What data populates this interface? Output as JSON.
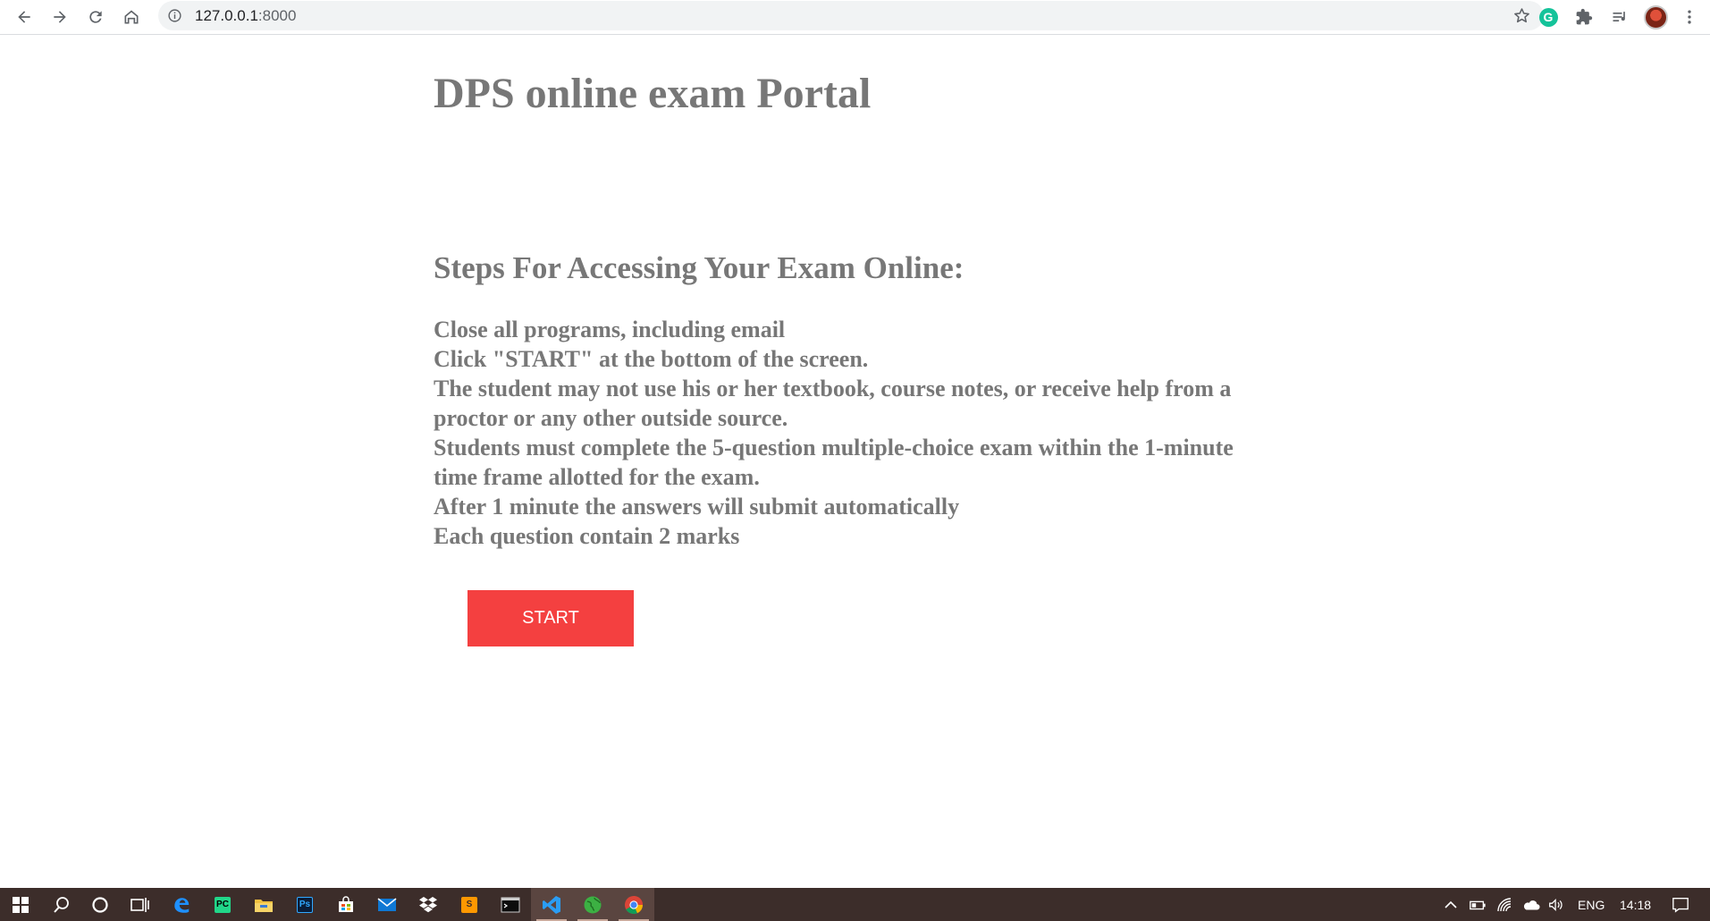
{
  "browser": {
    "url_host": "127.0.0.1",
    "url_port": ":8000",
    "grammarly_letter": "G",
    "icons": [
      "back-arrow-icon",
      "forward-arrow-icon",
      "reload-icon",
      "home-icon",
      "info-icon",
      "bookmark-star-icon",
      "grammarly-icon",
      "extensions-puzzle-icon",
      "reading-list-icon",
      "profile-avatar",
      "more-vert-icon"
    ]
  },
  "page": {
    "title": "DPS online exam Portal",
    "steps_heading": "Steps For Accessing Your Exam Online:",
    "steps": [
      "Close all programs, including email",
      "Click \"START\" at the bottom of the screen.",
      "The student may not use his or her textbook, course notes, or receive help from a proctor or any other outside source.",
      "Students must complete the 5-question multiple-choice exam within the 1-minute time frame allotted for the exam.",
      "After 1 minute the answers will submit automatically",
      "Each question contain 2 marks"
    ],
    "start_label": "START"
  },
  "taskbar": {
    "photoshop_label": "Ps",
    "pycharm_label": "PC",
    "sublime_label": "S",
    "language": "ENG",
    "time": "14:18"
  },
  "colors": {
    "text_gray": "#777777",
    "start_button": "#f44040",
    "taskbar": "#3c2d2a",
    "omnibox": "#f1f3f4"
  }
}
